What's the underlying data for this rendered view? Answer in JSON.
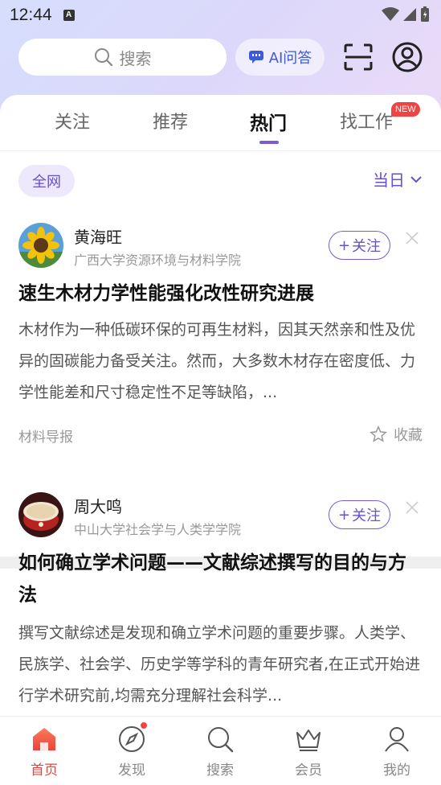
{
  "status_bar": {
    "time": "12:44",
    "notif_icon": "A"
  },
  "header": {
    "search_placeholder": "搜索",
    "ai_label": "AI问答"
  },
  "tabs": [
    {
      "label": "关注"
    },
    {
      "label": "推荐"
    },
    {
      "label": "热门",
      "active": true
    },
    {
      "label": "找工作",
      "badge": "NEW"
    }
  ],
  "filter": {
    "scope": "全网",
    "date": "当日"
  },
  "articles": [
    {
      "author": "黄海旺",
      "org": "广西大学资源环境与材料学院",
      "follow": "关注",
      "title": "速生木材力学性能强化改性研究进展",
      "body": "木材作为一种低碳环保的可再生材料，因其天然亲和性及优异的固碳能力备受关注。然而，大多数木材存在密度低、力学性能差和尺寸稳定性不足等缺陷，...",
      "source": "材料导报",
      "fav_label": "收藏"
    },
    {
      "author": "周大鸣",
      "org": "中山大学社会学与人类学学院",
      "follow": "关注",
      "title": "如何确立学术问题——文献综述撰写的目的与方法",
      "body": "撰写文献综述是发现和确立学术问题的重要步骤。人类学、民族学、社会学、历史学等学科的青年研究者,在正式开始进行学术研究前,均需充分理解社会科学..."
    }
  ],
  "bottom_nav": [
    {
      "label": "首页",
      "icon": "home-icon",
      "active": true
    },
    {
      "label": "发现",
      "icon": "compass-icon",
      "dot": true
    },
    {
      "label": "搜索",
      "icon": "search-icon"
    },
    {
      "label": "会员",
      "icon": "crown-icon"
    },
    {
      "label": "我的",
      "icon": "user-icon"
    }
  ],
  "colors": {
    "accent": "#6b4fd1",
    "active_nav": "#e8453c",
    "badge": "#ef4444"
  }
}
